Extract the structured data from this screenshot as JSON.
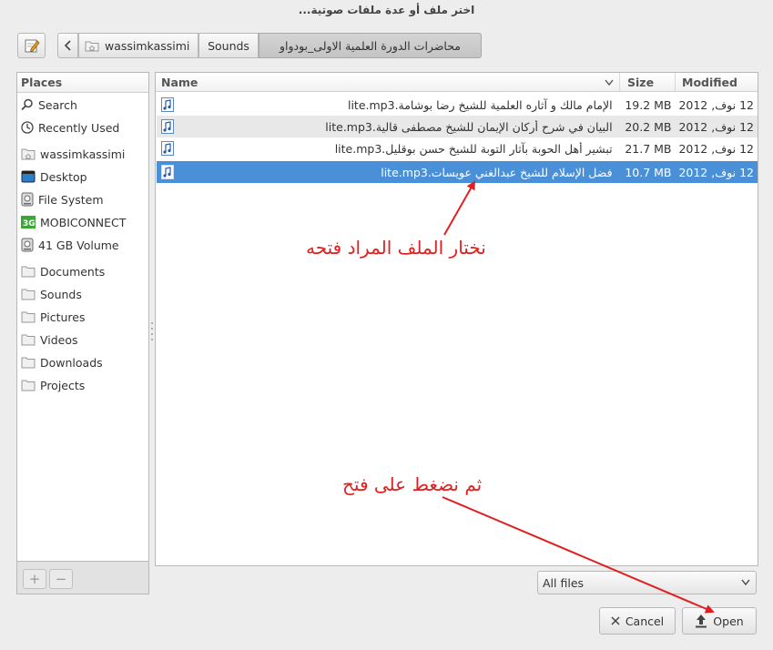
{
  "window": {
    "title": "اختر ملف أو عدة ملفات صوتية..."
  },
  "breadcrumb": {
    "items": [
      "wassimkassimi",
      "Sounds",
      "محاضرات الدورة العلمية الاولى_بودواو"
    ]
  },
  "places": {
    "header": "Places",
    "items": [
      {
        "label": "Search",
        "icon": "search-icon"
      },
      {
        "label": "Recently Used",
        "icon": "clock-icon"
      },
      {
        "label": "wassimkassimi",
        "icon": "home-folder-icon"
      },
      {
        "label": "Desktop",
        "icon": "desktop-icon"
      },
      {
        "label": "File System",
        "icon": "harddisk-icon"
      },
      {
        "label": "MOBICONNECT",
        "icon": "usb-drive-icon"
      },
      {
        "label": "41 GB Volume",
        "icon": "harddisk-icon"
      },
      {
        "label": "Documents",
        "icon": "folder-icon"
      },
      {
        "label": "Sounds",
        "icon": "folder-icon"
      },
      {
        "label": "Pictures",
        "icon": "folder-icon"
      },
      {
        "label": "Videos",
        "icon": "folder-icon"
      },
      {
        "label": "Downloads",
        "icon": "folder-icon"
      },
      {
        "label": "Projects",
        "icon": "folder-icon"
      }
    ],
    "add_label": "+",
    "remove_label": "−"
  },
  "files": {
    "columns": {
      "name": "Name",
      "size": "Size",
      "modified": "Modified"
    },
    "rows": [
      {
        "name": "الإمام مالك و آثاره العلمية للشيخ رضا بوشامة.lite.mp3",
        "size": "19.2 MB",
        "modified": "12 نوف, 2012"
      },
      {
        "name": "البيان في شرح أركان الإيمان للشيخ مصطفى قالية.lite.mp3",
        "size": "20.2 MB",
        "modified": "12 نوف, 2012"
      },
      {
        "name": "تبشير أهل الحوبة بآثار التوبة للشيخ حسن بوقليل.lite.mp3",
        "size": "21.7 MB",
        "modified": "12 نوف, 2012"
      },
      {
        "name": "فضل الإسلام للشيخ عبدالغني عويسات.lite.mp3",
        "size": "10.7 MB",
        "modified": "12 نوف, 2012",
        "selected": true
      }
    ]
  },
  "filter": {
    "value": "All files"
  },
  "buttons": {
    "cancel": "Cancel",
    "open": "Open"
  },
  "annotations": {
    "select_file": "نختار الملف المراد فتحه",
    "press_open": "ثم نضغط على فتح",
    "color": "#e02020"
  }
}
